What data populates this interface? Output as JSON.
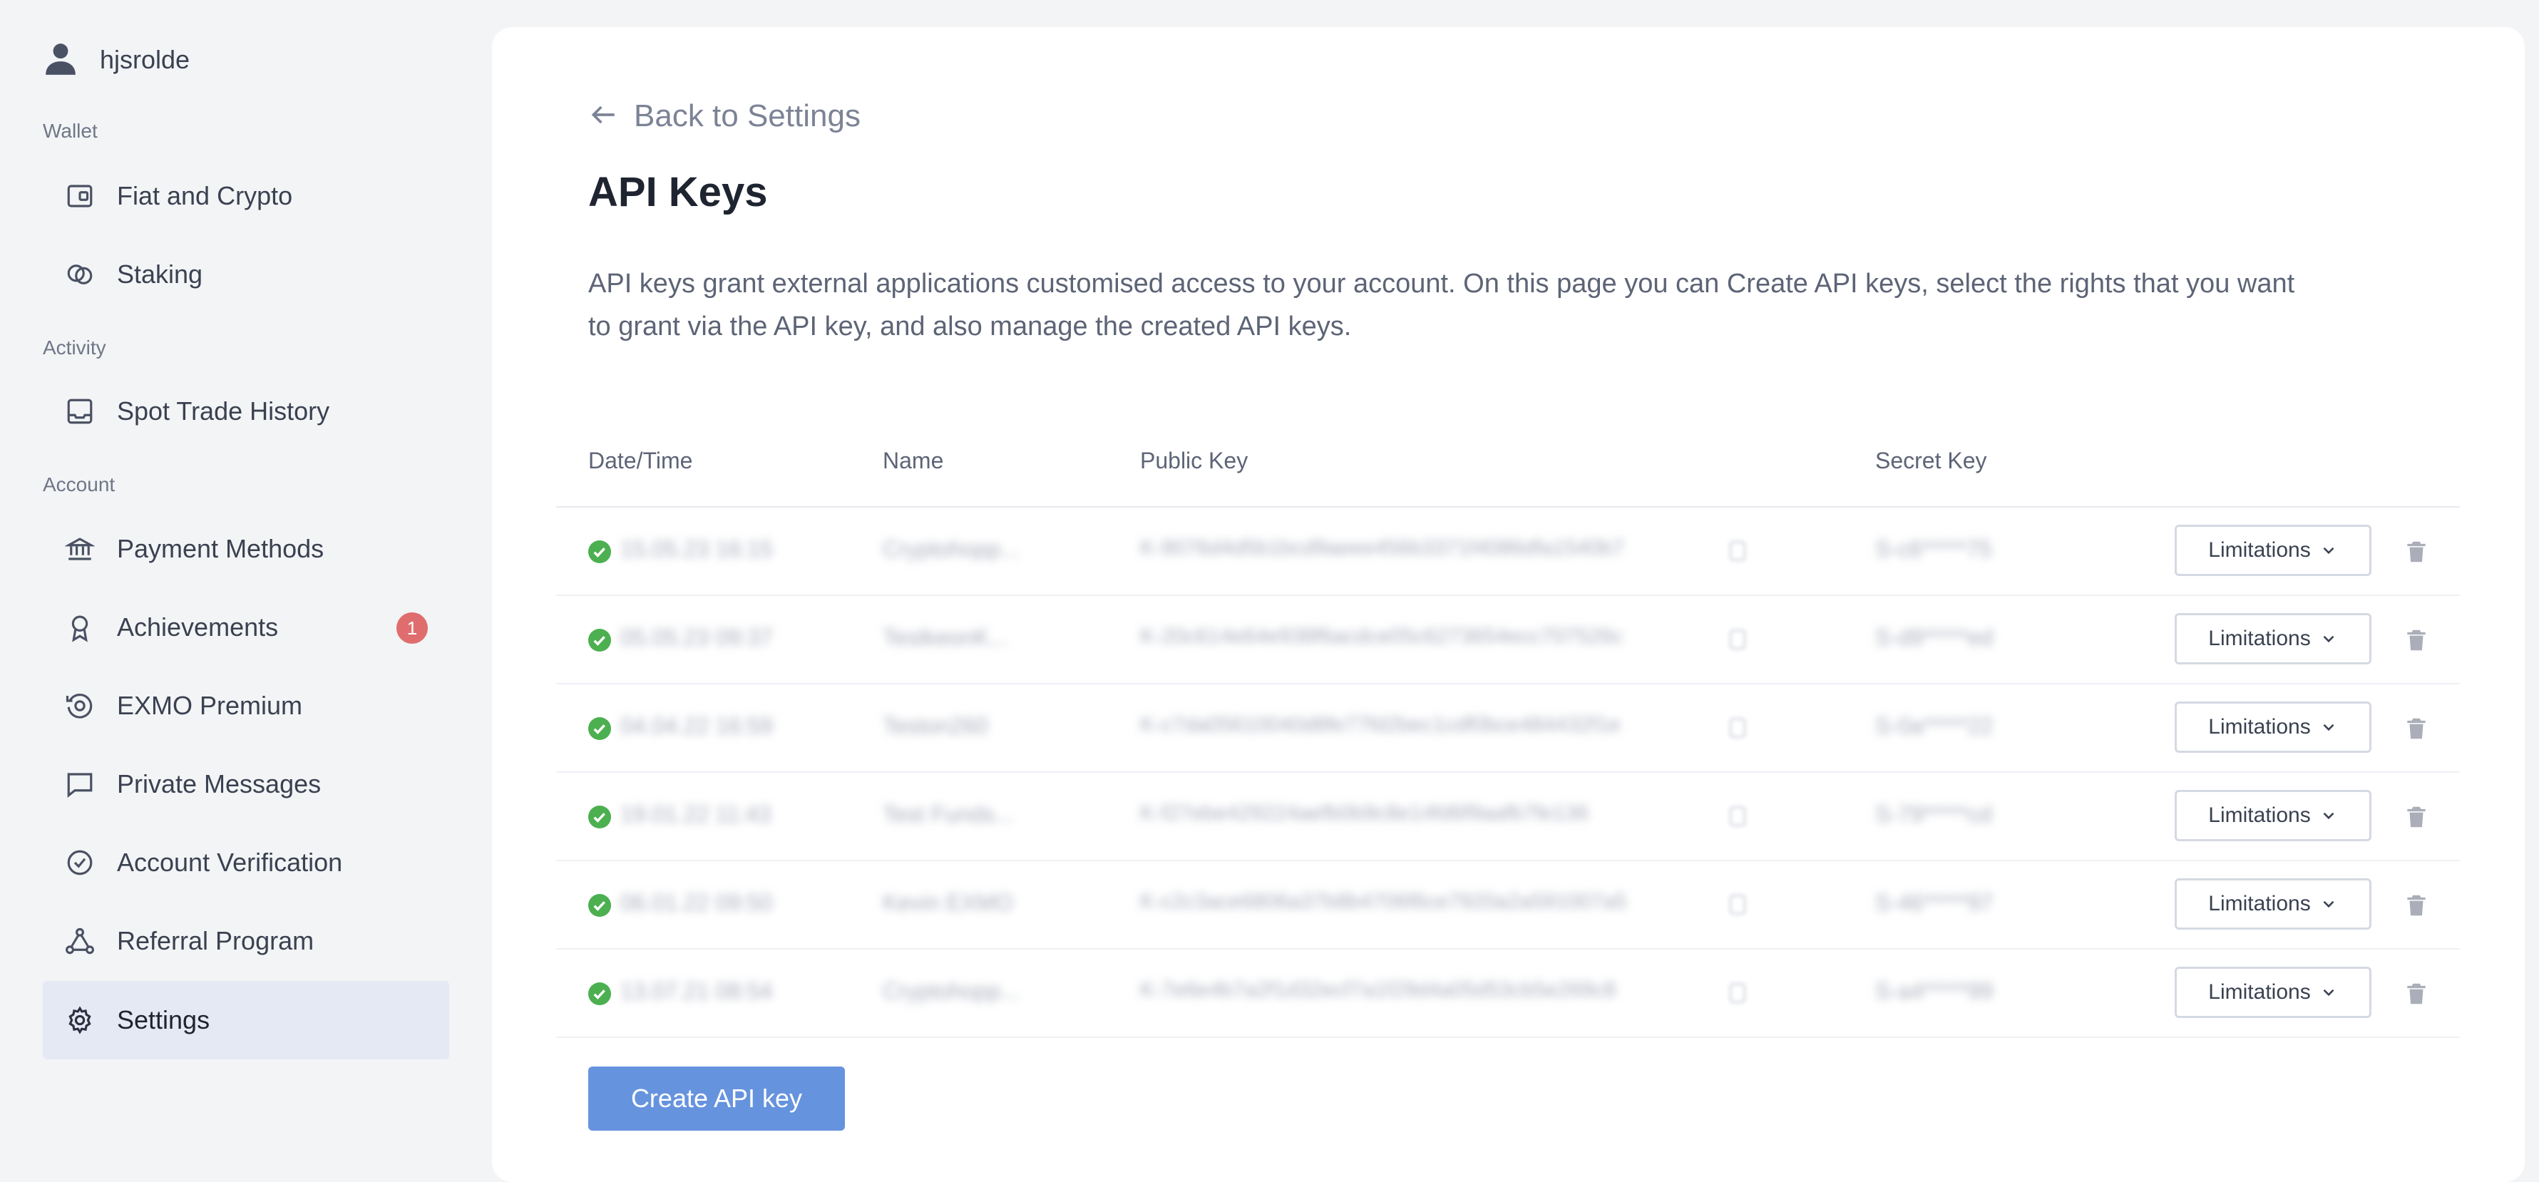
{
  "sidebar": {
    "username": "hjsrolde",
    "sections": {
      "wallet": "Wallet",
      "activity": "Activity",
      "account": "Account"
    },
    "items": {
      "fiat_crypto": "Fiat and Crypto",
      "staking": "Staking",
      "spot_trade_history": "Spot Trade History",
      "payment_methods": "Payment Methods",
      "achievements": "Achievements",
      "achievements_badge": "1",
      "exmo_premium": "EXMO Premium",
      "private_messages": "Private Messages",
      "account_verification": "Account Verification",
      "referral_program": "Referral Program",
      "settings": "Settings"
    },
    "active_item": "Settings"
  },
  "main": {
    "back_label": "Back to Settings",
    "title": "API Keys",
    "description": "API keys grant external applications customised access to your account. On this page you can Create API keys, select the rights that you want to grant via the API key, and also manage the created API keys.",
    "columns": {
      "datetime": "Date/Time",
      "name": "Name",
      "public_key": "Public Key",
      "secret_key": "Secret Key"
    },
    "rows": [
      {
        "datetime": "15.05.23 16:15",
        "name": "Cryptohopp...",
        "public_key": "K-9076d4d5b1bcd9aeee456b3371f4086dfa1540b7",
        "secret_key": "S-c6*****75",
        "limit_label": "Limitations"
      },
      {
        "datetime": "05.05.23 09:37",
        "name": "TestkeonK...",
        "public_key": "K-20c614e64e938f6acdce05c6273654ecc707526c",
        "secret_key": "S-d9*****ed",
        "limit_label": "Limitations"
      },
      {
        "datetime": "04.04.22 16:59",
        "name": "Teston260",
        "public_key": "K-c7da05610040d8fe77fd2bec1cdf0bce484432f1e",
        "secret_key": "S-0a*****22",
        "limit_label": "Limitations"
      },
      {
        "datetime": "19.01.22 11:43",
        "name": "Test Funds...",
        "public_key": "K-f27ebe429224aefb0b9c8e14fd6f9aafb7fe136",
        "secret_key": "S-79*****cd",
        "limit_label": "Limitations"
      },
      {
        "datetime": "06.01.22 09:50",
        "name": "Kevin EXMO",
        "public_key": "K-c2c3ace6806a37b8b4706f6ce7920a2a591007a5",
        "secret_key": "S-46*****97",
        "limit_label": "Limitations"
      },
      {
        "datetime": "13.07.21 08:54",
        "name": "Cryptohopp...",
        "public_key": "K-7e6e4b7a2f1d32ecf7a1f29d4a05d53cb5e269c8",
        "secret_key": "S-a4*****99",
        "limit_label": "Limitations"
      }
    ],
    "create_button": "Create API key"
  },
  "colors": {
    "accent": "#6693de",
    "active_bg": "#e4e9f3",
    "badge": "#e06d6d",
    "success": "#4caf50"
  }
}
